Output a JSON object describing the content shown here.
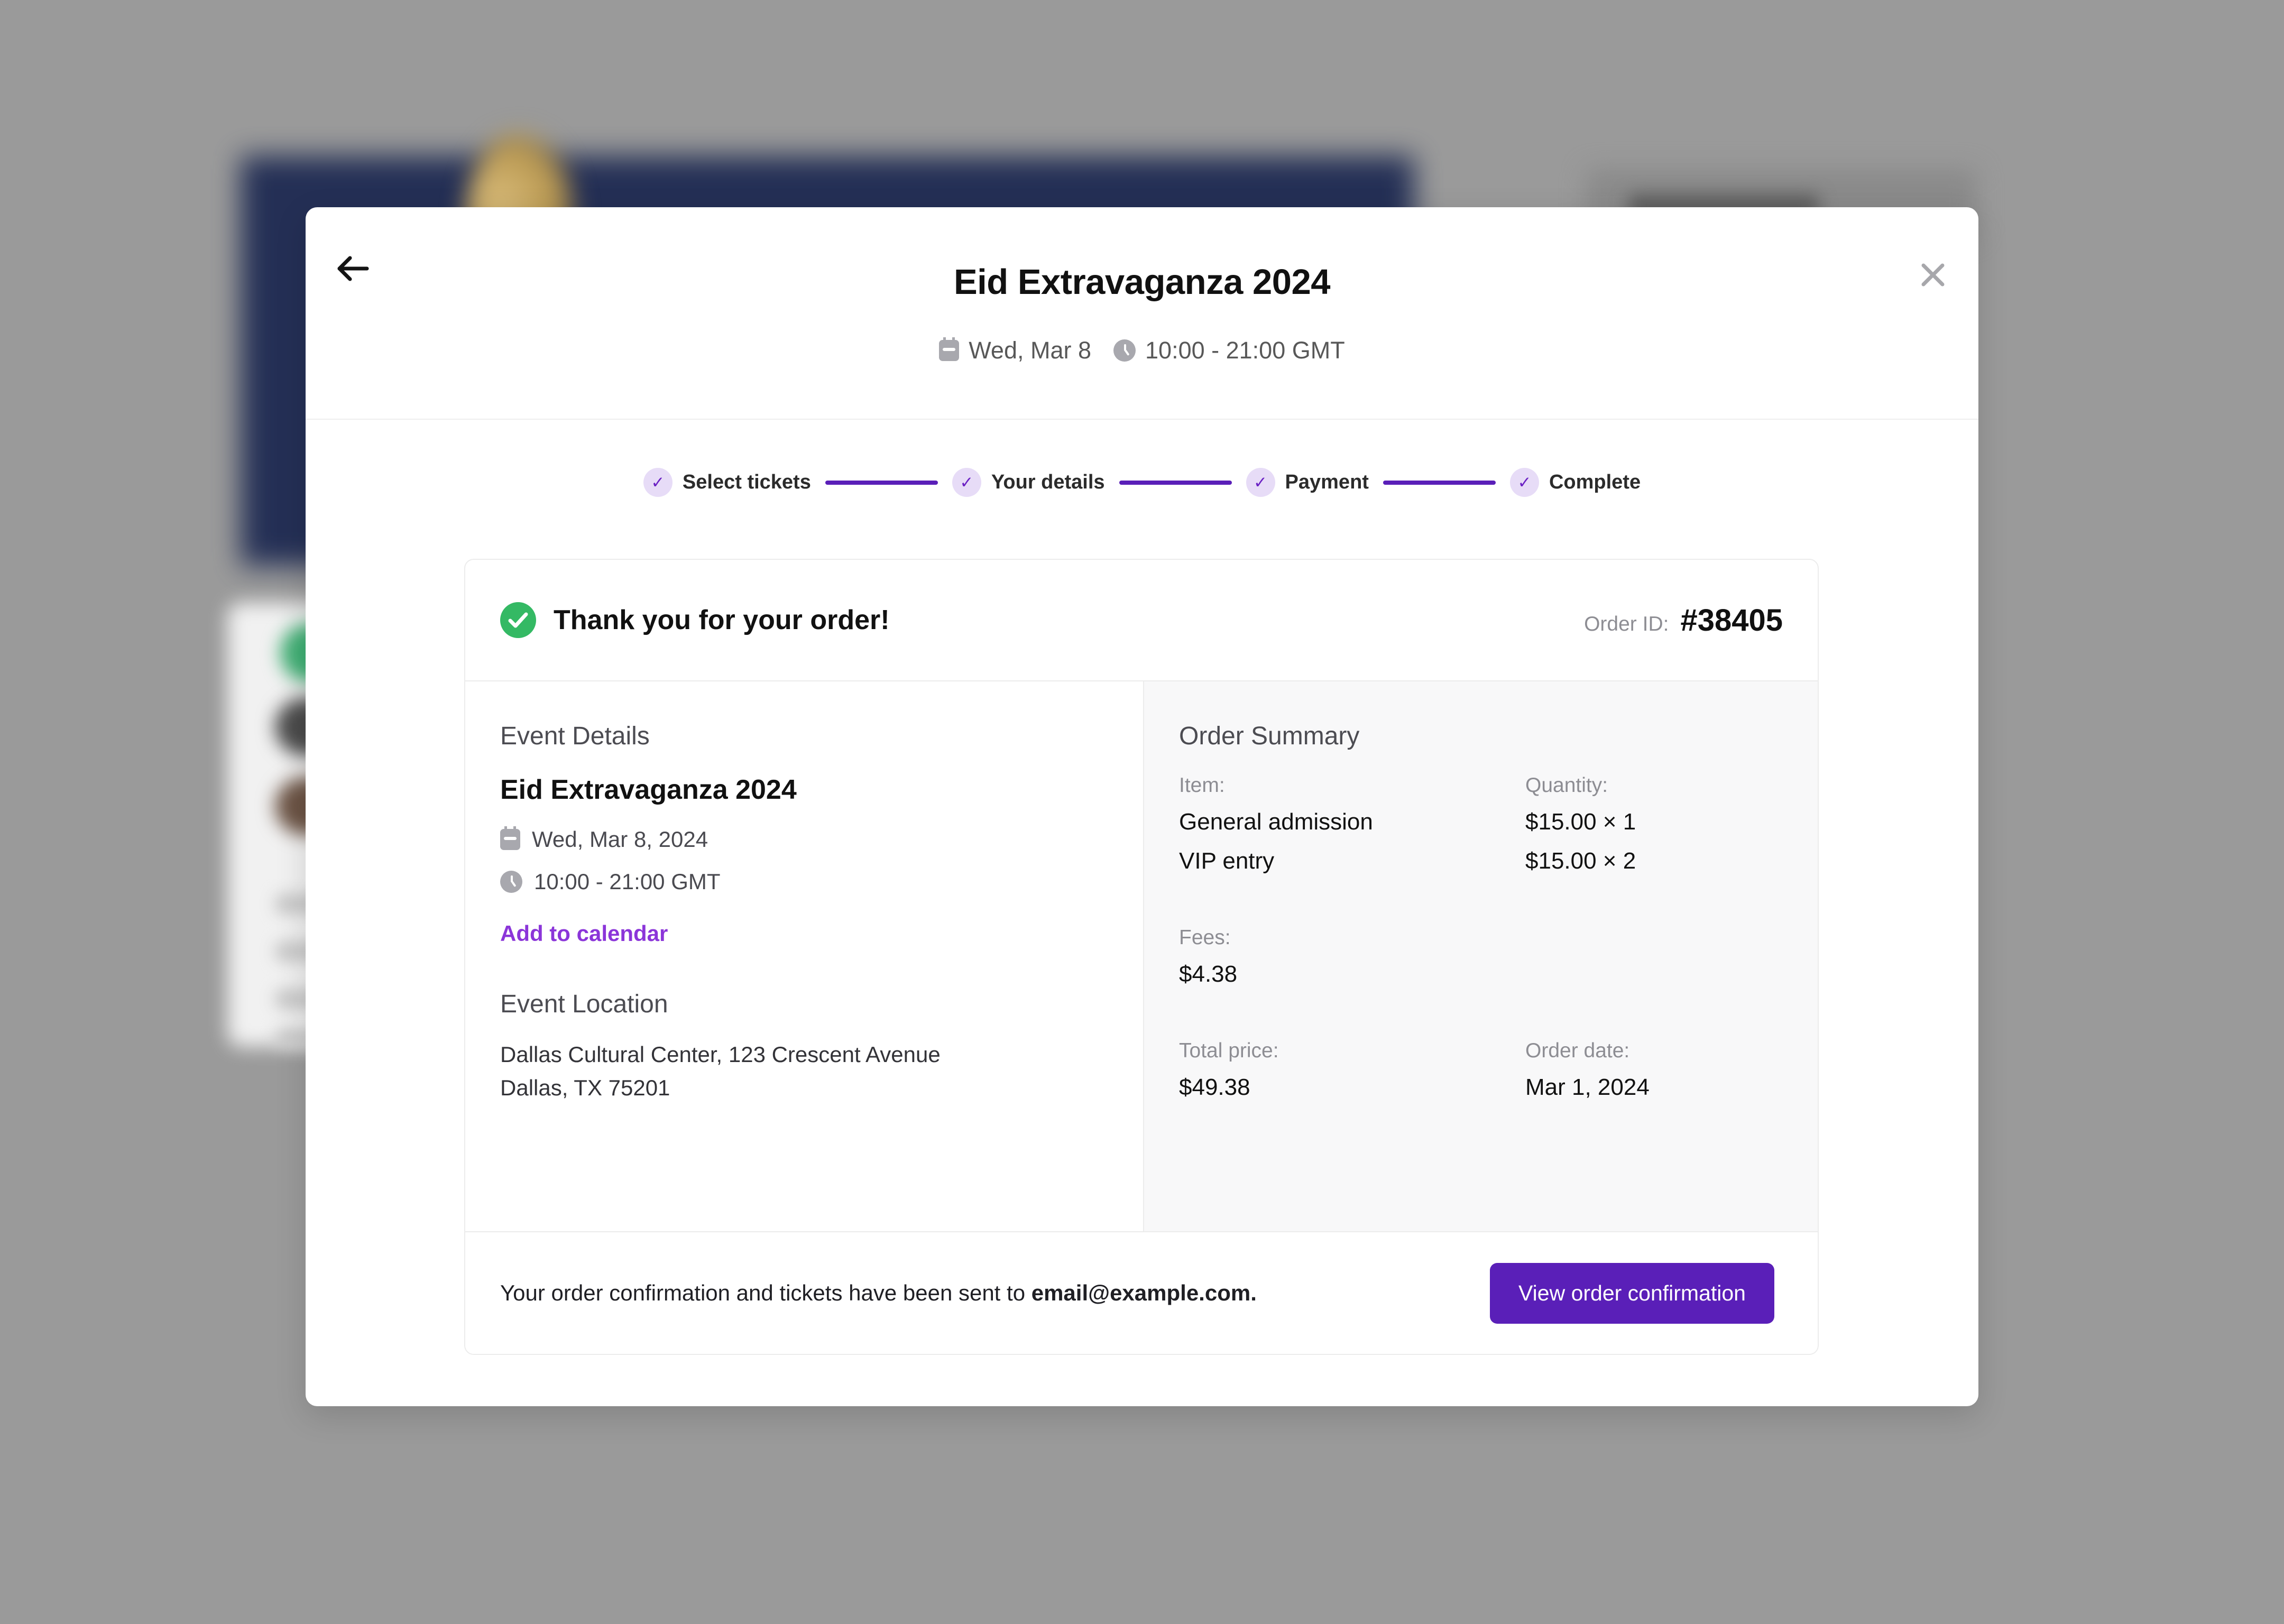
{
  "modal": {
    "back_icon": "arrow-left-icon",
    "close_icon": "close-icon",
    "title": "Eid Extravaganza 2024",
    "meta": {
      "calendar_icon": "calendar-icon",
      "date": "Wed, Mar 8",
      "clock_icon": "clock-icon",
      "time": "10:00 - 21:00 GMT"
    }
  },
  "stepper": {
    "check_glyph": "✓",
    "steps": [
      {
        "label": "Select tickets",
        "completed": true
      },
      {
        "label": "Your details",
        "completed": true
      },
      {
        "label": "Payment",
        "completed": true
      },
      {
        "label": "Complete",
        "completed": true
      }
    ]
  },
  "confirmation": {
    "success_icon": "check-circle-icon",
    "success_glyph": "✔",
    "heading": "Thank you for your order!",
    "order_id_label": "Order ID:",
    "order_id_value": "#38405"
  },
  "event_details": {
    "section_title": "Event Details",
    "event_name": "Eid Extravaganza 2024",
    "date": "Wed, Mar 8, 2024",
    "time": "10:00 - 21:00 GMT",
    "add_to_calendar": "Add to calendar",
    "location_title": "Event Location",
    "location_line1": "Dallas Cultural Center, 123 Crescent Avenue",
    "location_line2": "Dallas, TX 75201"
  },
  "order_summary": {
    "section_title": "Order Summary",
    "item_label": "Item:",
    "quantity_label": "Quantity:",
    "items": [
      {
        "name": "General admission",
        "quantity": "$15.00 × 1"
      },
      {
        "name": "VIP entry",
        "quantity": "$15.00 × 2"
      }
    ],
    "fees_label": "Fees:",
    "fees_value": "$4.38",
    "total_label": "Total price:",
    "total_value": "$49.38",
    "order_date_label": "Order date:",
    "order_date_value": "Mar 1, 2024"
  },
  "footer": {
    "message_prefix": "Your order confirmation and tickets have been sent to ",
    "message_email": "email@example.com.",
    "button_label": "View order confirmation"
  },
  "colors": {
    "brand_purple": "#5A1FB8",
    "link_purple": "#8B35D9",
    "step_circle_bg": "#E7DCF7",
    "step_check": "#6B21C4",
    "success_green": "#34B964",
    "panel_gray": "#F8F8F9",
    "backdrop_gray": "#999999"
  }
}
